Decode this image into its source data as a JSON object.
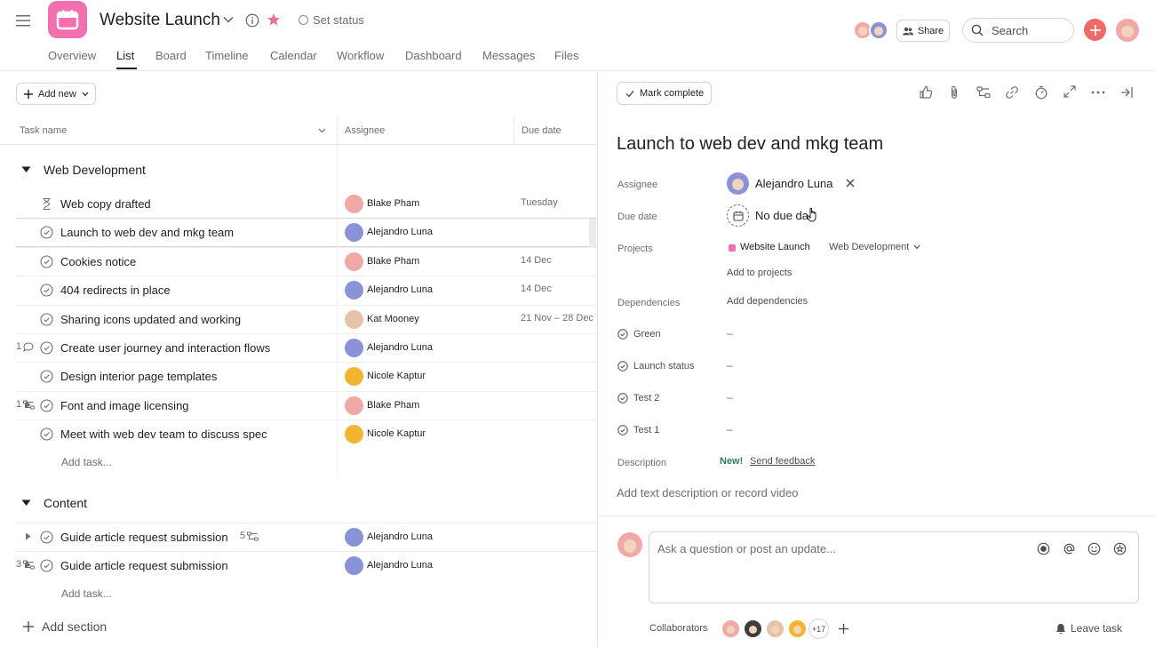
{
  "header": {
    "project_title": "Website Launch",
    "set_status": "Set status",
    "share": "Share",
    "search_placeholder": "Search"
  },
  "tabs": [
    "Overview",
    "List",
    "Board",
    "Timeline",
    "Calendar",
    "Workflow",
    "Dashboard",
    "Messages",
    "Files"
  ],
  "active_tab": "List",
  "toolbar": {
    "add_new": "Add new"
  },
  "columns": {
    "task_name": "Task name",
    "assignee": "Assignee",
    "due_date": "Due date"
  },
  "sections": [
    {
      "name": "Web Development",
      "tasks": [
        {
          "name": "Web copy drafted",
          "assignee": "Blake Pham",
          "due": "Tuesday",
          "icon": "hourglass"
        },
        {
          "name": "Launch to web dev and mkg team",
          "assignee": "Alejandro Luna",
          "due": ""
        },
        {
          "name": "Cookies notice",
          "assignee": "Blake Pham",
          "due": "14 Dec"
        },
        {
          "name": "404 redirects in place",
          "assignee": "Alejandro Luna",
          "due": "14 Dec"
        },
        {
          "name": "Sharing icons updated and working",
          "assignee": "Kat Mooney",
          "due": "21 Nov – 28 Dec"
        },
        {
          "name": "Create user journey and interaction flows",
          "assignee": "Alejandro Luna",
          "due": "",
          "comments": "1"
        },
        {
          "name": "Design interior page templates",
          "assignee": "Nicole Kaptur",
          "due": ""
        },
        {
          "name": "Font and image licensing",
          "assignee": "Blake Pham",
          "due": "",
          "subtasks": "1"
        },
        {
          "name": "Meet with web dev team to discuss spec",
          "assignee": "Nicole Kaptur",
          "due": ""
        }
      ],
      "add_task": "Add task..."
    },
    {
      "name": "Content",
      "tasks": [
        {
          "name": "Guide article request submission",
          "assignee": "Alejandro Luna",
          "due": "",
          "subtasks": "5"
        },
        {
          "name": "Guide article request submission",
          "assignee": "Alejandro Luna",
          "due": "",
          "subtasks": "3"
        }
      ],
      "add_task": "Add task..."
    }
  ],
  "add_section": "Add section",
  "detail": {
    "mark_complete": "Mark complete",
    "title": "Launch to web dev and mkg team",
    "labels": {
      "assignee": "Assignee",
      "due_date": "Due date",
      "projects": "Projects",
      "dependencies": "Dependencies",
      "description": "Description"
    },
    "assignee": "Alejandro Luna",
    "due": "No due date",
    "project": "Website Launch",
    "section": "Web Development",
    "add_to_projects": "Add to projects",
    "add_dependencies": "Add dependencies",
    "fields": [
      {
        "name": "Green",
        "value": "–"
      },
      {
        "name": "Launch status",
        "value": "–"
      },
      {
        "name": "Test 2",
        "value": "–"
      },
      {
        "name": "Test 1",
        "value": "–"
      }
    ],
    "new_badge": "New!",
    "send_feedback": "Send feedback",
    "description_placeholder": "Add text description or record video",
    "comment_placeholder": "Ask a question or post an update...",
    "collaborators_label": "Collaborators",
    "collaborators_more": "+17",
    "leave_task": "Leave task"
  },
  "colors": {
    "accent": "#f06a6a",
    "project_icon_bg": "#f26fb0",
    "star": "#f06a9e",
    "new_green": "#2b7d57",
    "project_dot": "#f26fb0"
  }
}
